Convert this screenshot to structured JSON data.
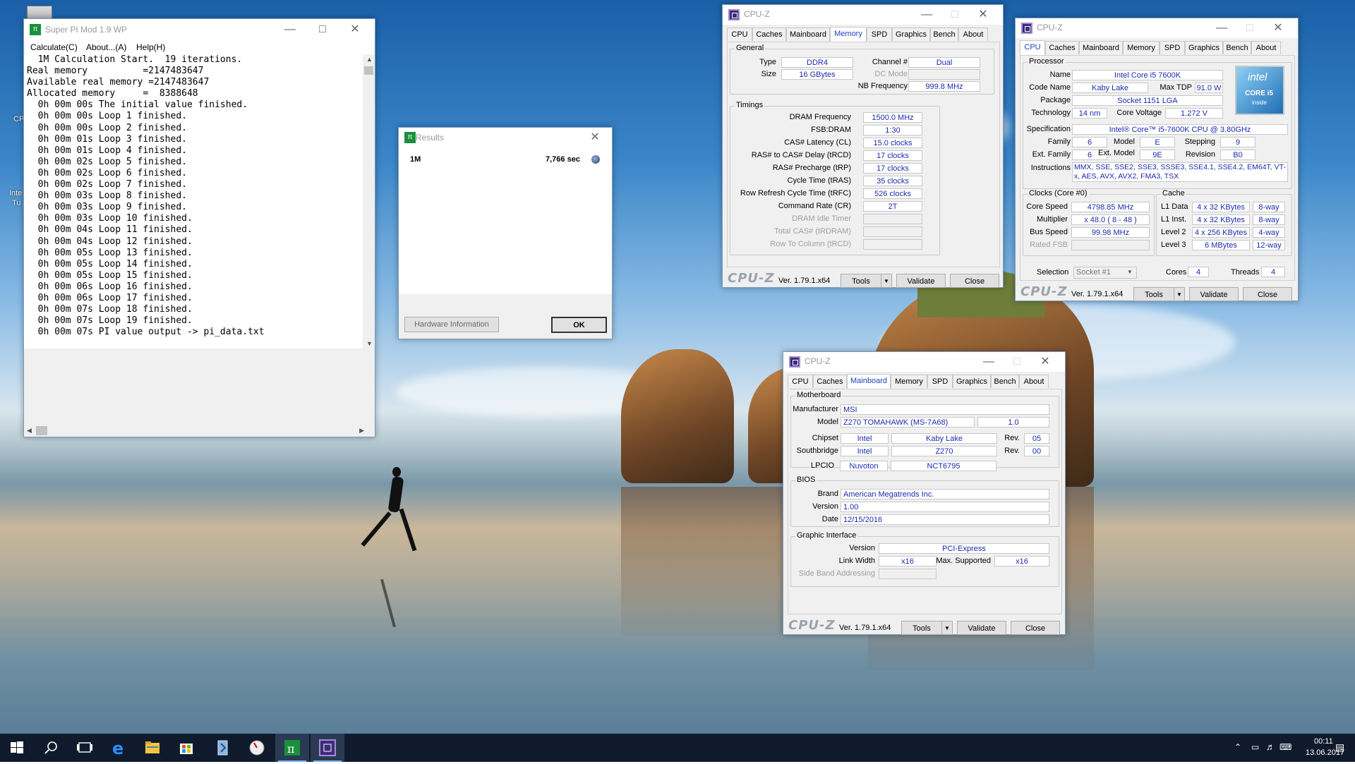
{
  "desktop": {
    "icon_labels": [
      "CP",
      "Inte",
      "Tu"
    ]
  },
  "superpi": {
    "title": "Super PI Mod 1.9 WP",
    "menu": [
      "Calculate(C)",
      "About...(A)",
      "Help(H)"
    ],
    "lines": [
      "  1M Calculation Start.  19 iterations.",
      "Real memory          =2147483647",
      "Available real memory =2147483647",
      "Allocated memory     =  8388648",
      "  0h 00m 00s The initial value finished.",
      "  0h 00m 00s Loop 1 finished.",
      "  0h 00m 00s Loop 2 finished.",
      "  0h 00m 01s Loop 3 finished.",
      "  0h 00m 01s Loop 4 finished.",
      "  0h 00m 02s Loop 5 finished.",
      "  0h 00m 02s Loop 6 finished.",
      "  0h 00m 02s Loop 7 finished.",
      "  0h 00m 03s Loop 8 finished.",
      "  0h 00m 03s Loop 9 finished.",
      "  0h 00m 03s Loop 10 finished.",
      "  0h 00m 04s Loop 11 finished.",
      "  0h 00m 04s Loop 12 finished.",
      "  0h 00m 05s Loop 13 finished.",
      "  0h 00m 05s Loop 14 finished.",
      "  0h 00m 05s Loop 15 finished.",
      "  0h 00m 06s Loop 16 finished.",
      "  0h 00m 06s Loop 17 finished.",
      "  0h 00m 07s Loop 18 finished.",
      "  0h 00m 07s Loop 19 finished.",
      "  0h 00m 07s PI value output -> pi_data.txt"
    ]
  },
  "results": {
    "title": "Results",
    "label": "1M",
    "time": "7,766 sec",
    "hw_button": "Hardware Information",
    "ok_button": "OK"
  },
  "cpuz_common": {
    "title": "CPU-Z",
    "tabs": [
      "CPU",
      "Caches",
      "Mainboard",
      "Memory",
      "SPD",
      "Graphics",
      "Bench",
      "About"
    ],
    "brand": "CPU-Z",
    "version": "Ver. 1.79.1.x64",
    "tools": "Tools",
    "validate": "Validate",
    "close": "Close"
  },
  "memory": {
    "general_title": "General",
    "type_label": "Type",
    "type": "DDR4",
    "size_label": "Size",
    "size": "16 GBytes",
    "channel_label": "Channel #",
    "channel": "Dual",
    "dcmode_label": "DC Mode",
    "nbfreq_label": "NB Frequency",
    "nbfreq": "999.8 MHz",
    "timings_title": "Timings",
    "timings": [
      {
        "label": "DRAM Frequency",
        "value": "1500.0 MHz",
        "dim": false
      },
      {
        "label": "FSB:DRAM",
        "value": "1:30",
        "dim": false
      },
      {
        "label": "CAS# Latency (CL)",
        "value": "15.0 clocks",
        "dim": false
      },
      {
        "label": "RAS# to CAS# Delay (tRCD)",
        "value": "17 clocks",
        "dim": false
      },
      {
        "label": "RAS# Precharge (tRP)",
        "value": "17 clocks",
        "dim": false
      },
      {
        "label": "Cycle Time (tRAS)",
        "value": "35 clocks",
        "dim": false
      },
      {
        "label": "Row Refresh Cycle Time (tRFC)",
        "value": "526 clocks",
        "dim": false
      },
      {
        "label": "Command Rate (CR)",
        "value": "2T",
        "dim": false
      },
      {
        "label": "DRAM Idle Timer",
        "value": "",
        "dim": true
      },
      {
        "label": "Total CAS# (tRDRAM)",
        "value": "",
        "dim": true
      },
      {
        "label": "Row To Column (tRCD)",
        "value": "",
        "dim": true
      }
    ]
  },
  "cpu": {
    "processor_title": "Processor",
    "name_label": "Name",
    "name": "Intel Core i5 7600K",
    "codename_label": "Code Name",
    "codename": "Kaby Lake",
    "maxtdp_label": "Max TDP",
    "maxtdp": "91.0 W",
    "package_label": "Package",
    "package": "Socket 1151 LGA",
    "tech_label": "Technology",
    "tech": "14 nm",
    "voltage_label": "Core Voltage",
    "voltage": "1.272 V",
    "spec_label": "Specification",
    "spec": "Intel® Core™ i5-7600K CPU @ 3.80GHz",
    "family_label": "Family",
    "family": "6",
    "model_label": "Model",
    "model": "E",
    "stepping_label": "Stepping",
    "stepping": "9",
    "extfamily_label": "Ext. Family",
    "extfamily": "6",
    "extmodel_label": "Ext. Model",
    "extmodel": "9E",
    "revision_label": "Revision",
    "revision": "B0",
    "instr_label": "Instructions",
    "instr": "MMX, SSE, SSE2, SSE3, SSSE3, SSE4.1, SSE4.2, EM64T, VT-x, AES, AVX, AVX2, FMA3, TSX",
    "logo_brand": "intel",
    "logo_line1": "CORE i5",
    "logo_line2": "inside",
    "clocks_title": "Clocks (Core #0)",
    "corespeed_label": "Core Speed",
    "corespeed": "4798.85 MHz",
    "multiplier_label": "Multiplier",
    "multiplier": "x 48.0 ( 8 - 48 )",
    "busspeed_label": "Bus Speed",
    "busspeed": "99.98 MHz",
    "ratedfsb_label": "Rated FSB",
    "cache_title": "Cache",
    "cache": [
      {
        "label": "L1 Data",
        "size": "4 x 32 KBytes",
        "way": "8-way"
      },
      {
        "label": "L1 Inst.",
        "size": "4 x 32 KBytes",
        "way": "8-way"
      },
      {
        "label": "Level 2",
        "size": "4 x 256 KBytes",
        "way": "4-way"
      },
      {
        "label": "Level 3",
        "size": "6 MBytes",
        "way": "12-way"
      }
    ],
    "selection_label": "Selection",
    "selection": "Socket #1",
    "cores_label": "Cores",
    "cores": "4",
    "threads_label": "Threads",
    "threads": "4"
  },
  "mainboard": {
    "mb_title": "Motherboard",
    "manufacturer_label": "Manufacturer",
    "manufacturer": "MSI",
    "model_label": "Model",
    "model": "Z270 TOMAHAWK (MS-7A68)",
    "model_rev": "1.0",
    "chipset_label": "Chipset",
    "chipset_vendor": "Intel",
    "chipset": "Kaby Lake",
    "rev_label": "Rev.",
    "chipset_rev": "05",
    "south_label": "Southbridge",
    "south_vendor": "Intel",
    "south": "Z270",
    "south_rev": "00",
    "lpcio_label": "LPCIO",
    "lpcio_vendor": "Nuvoton",
    "lpcio": "NCT6795",
    "bios_title": "BIOS",
    "brand_label": "Brand",
    "brand": "American Megatrends Inc.",
    "version_label": "Version",
    "version": "1.00",
    "date_label": "Date",
    "date": "12/15/2016",
    "gi_title": "Graphic Interface",
    "gi_version_label": "Version",
    "gi_version": "PCI-Express",
    "linkwidth_label": "Link Width",
    "linkwidth": "x16",
    "maxsup_label": "Max. Supported",
    "maxsup": "x16",
    "sideband_label": "Side Band Addressing"
  },
  "taskbar": {
    "time": "00:11",
    "date": "13.06.2017"
  }
}
